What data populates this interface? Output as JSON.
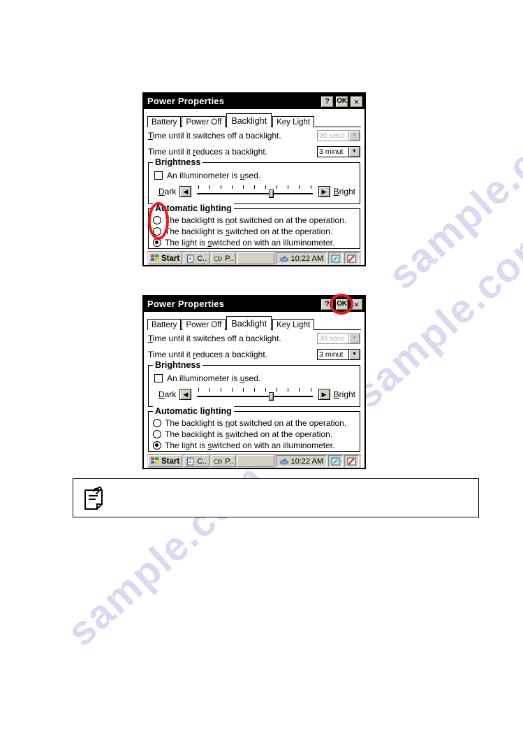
{
  "page": {
    "watermark_text": "sample.com"
  },
  "dialogs": [
    {
      "id": "dialog-1",
      "title": "Power Properties",
      "titlebar_buttons": {
        "help": "?",
        "ok": "OK",
        "close": "×"
      },
      "tabs": [
        {
          "label": "Battery",
          "active": false
        },
        {
          "label": "Power Off",
          "active": false
        },
        {
          "label": "Backlight",
          "active": true
        },
        {
          "label": "Key Light",
          "active": false
        }
      ],
      "settings": [
        {
          "label": "Time until it switches off a backlight.",
          "value": "30 seco",
          "disabled": true
        },
        {
          "label": "Time until it reduces a backlight.",
          "value": "3 minut",
          "disabled": false
        }
      ],
      "brightness": {
        "group_title": "Brightness",
        "checkbox_label": "An illuminometer is used.",
        "checkbox_checked": false,
        "dark_label": "Dark",
        "bright_label": "Bright",
        "left_arrow": "◀",
        "right_arrow": "▶",
        "slider_percent": 62,
        "tick_count": 11
      },
      "automatic_lighting": {
        "group_title": "Automatic lighting",
        "options": [
          {
            "label": "The backlight is not switched on at the operation.",
            "selected": false
          },
          {
            "label": "The backlight is switched on at the operation.",
            "selected": false
          },
          {
            "label": "The light is switched on with an illuminometer.",
            "selected": true
          }
        ]
      },
      "taskbar": {
        "start_label": "Start",
        "tasks": [
          "C..",
          "P.."
        ],
        "clock": "10:22 AM",
        "tray_icons": [
          "input-panel-icon",
          "stylus-icon"
        ]
      },
      "annotation": "red-oval-around-radio-buttons"
    },
    {
      "id": "dialog-2",
      "title": "Power Properties",
      "titlebar_buttons": {
        "help": "?",
        "ok": "OK",
        "close": "×"
      },
      "tabs": [
        {
          "label": "Battery",
          "active": false
        },
        {
          "label": "Power Off",
          "active": false
        },
        {
          "label": "Backlight",
          "active": true
        },
        {
          "label": "Key Light",
          "active": false
        }
      ],
      "settings": [
        {
          "label": "Time until it switches off a backlight.",
          "value": "30 seco",
          "disabled": true
        },
        {
          "label": "Time until it reduces a backlight.",
          "value": "3 minut",
          "disabled": false
        }
      ],
      "brightness": {
        "group_title": "Brightness",
        "checkbox_label": "An illuminometer is used.",
        "checkbox_checked": false,
        "dark_label": "Dark",
        "bright_label": "Bright",
        "left_arrow": "◀",
        "right_arrow": "▶",
        "slider_percent": 62,
        "tick_count": 11
      },
      "automatic_lighting": {
        "group_title": "Automatic lighting",
        "options": [
          {
            "label": "The backlight is not switched on at the operation.",
            "selected": false
          },
          {
            "label": "The backlight is switched on at the operation.",
            "selected": false
          },
          {
            "label": "The light is switched on with an illuminometer.",
            "selected": true
          }
        ]
      },
      "taskbar": {
        "start_label": "Start",
        "tasks": [
          "C..",
          "P.."
        ],
        "clock": "10:22 AM",
        "tray_icons": [
          "input-panel-icon",
          "stylus-icon"
        ]
      },
      "annotation": "red-oval-around-ok-button"
    }
  ],
  "note_box": {
    "icon": "memo-note-icon",
    "text": ""
  }
}
